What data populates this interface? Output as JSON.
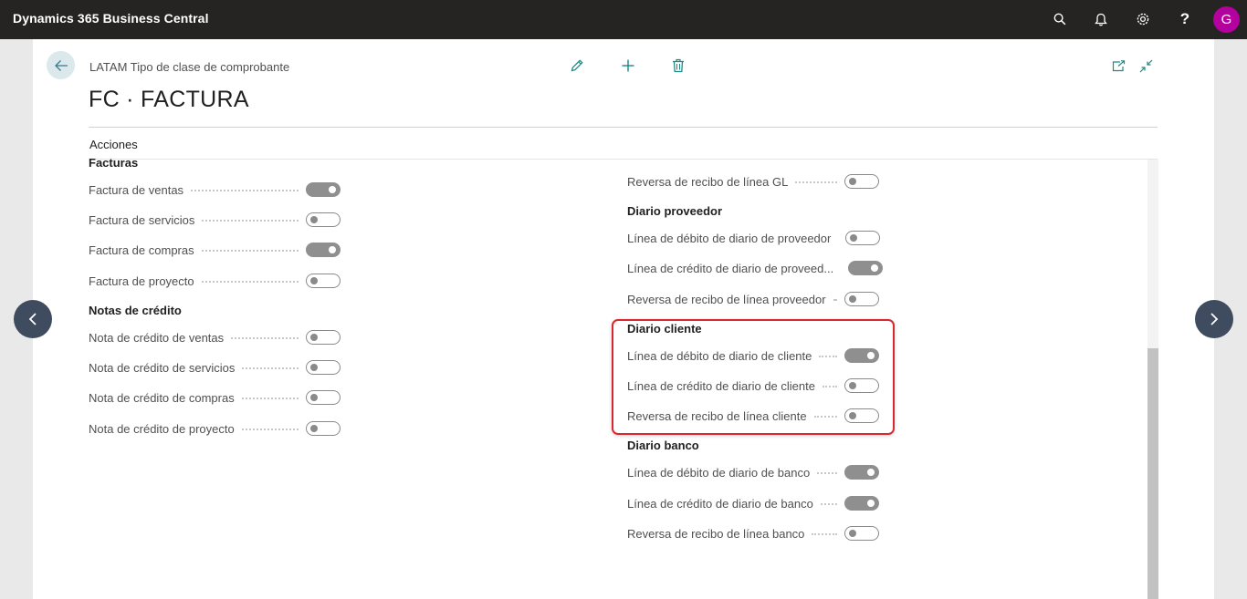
{
  "topbar": {
    "app_title": "Dynamics 365 Business Central",
    "icons": [
      "search-icon",
      "bell-icon",
      "gear-icon",
      "help-icon"
    ],
    "help_glyph": "?",
    "avatar_initial": "G",
    "avatar_color": "#b4009e"
  },
  "header": {
    "breadcrumb": "LATAM Tipo de clase de comprobante",
    "title": "FC · FACTURA",
    "actions_label": "Acciones"
  },
  "left": {
    "facturas": {
      "title": "Facturas",
      "fields": [
        {
          "label": "Factura de ventas",
          "on": true
        },
        {
          "label": "Factura de servicios",
          "on": false
        },
        {
          "label": "Factura de compras",
          "on": true
        },
        {
          "label": "Factura de proyecto",
          "on": false
        }
      ]
    },
    "notas": {
      "title": "Notas de crédito",
      "fields": [
        {
          "label": "Nota de crédito de ventas",
          "on": false
        },
        {
          "label": "Nota de crédito de servicios",
          "on": false
        },
        {
          "label": "Nota de crédito de compras",
          "on": false
        },
        {
          "label": "Nota de crédito de proyecto",
          "on": false
        }
      ]
    }
  },
  "right": {
    "gl": {
      "fields": [
        {
          "label": "Reversa de recibo de línea GL",
          "on": false
        }
      ]
    },
    "proveedor": {
      "title": "Diario proveedor",
      "fields": [
        {
          "label": "Línea de débito de diario de proveedor",
          "on": false
        },
        {
          "label": "Línea de crédito de diario de proveed...",
          "on": true
        },
        {
          "label": "Reversa de recibo de línea proveedor",
          "on": false
        }
      ]
    },
    "cliente": {
      "title": "Diario cliente",
      "fields": [
        {
          "label": "Línea de débito de diario de cliente",
          "on": true
        },
        {
          "label": "Línea de crédito de diario de cliente",
          "on": false
        },
        {
          "label": "Reversa de recibo de línea cliente",
          "on": false
        }
      ]
    },
    "banco": {
      "title": "Diario banco",
      "fields": [
        {
          "label": "Línea de débito de diario de banco",
          "on": true
        },
        {
          "label": "Línea de crédito de diario de banco",
          "on": true
        },
        {
          "label": "Reversa de recibo de línea banco",
          "on": false
        }
      ]
    }
  },
  "colors": {
    "highlight": "#d9272e",
    "toggle_on": "#8f8f8f",
    "nav_button": "#3f4b5e"
  }
}
